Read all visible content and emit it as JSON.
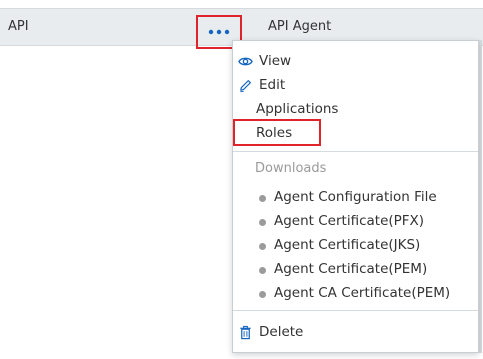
{
  "row": {
    "name": "API",
    "agent": "API Agent"
  },
  "menu": {
    "view": "View",
    "edit": "Edit",
    "applications": "Applications",
    "roles": "Roles",
    "downloads_header": "Downloads",
    "downloads": [
      "Agent Configuration File",
      "Agent Certificate(PFX)",
      "Agent Certificate(JKS)",
      "Agent Certificate(PEM)",
      "Agent CA Certificate(PEM)"
    ],
    "delete": "Delete"
  },
  "colors": {
    "accent_blue": "#1565c0",
    "highlight_red": "#e0232a",
    "row_bg": "#e8ecef"
  },
  "icons": {
    "more": "ellipsis-icon",
    "view": "eye-icon",
    "edit": "pencil-icon",
    "delete": "trash-icon"
  }
}
